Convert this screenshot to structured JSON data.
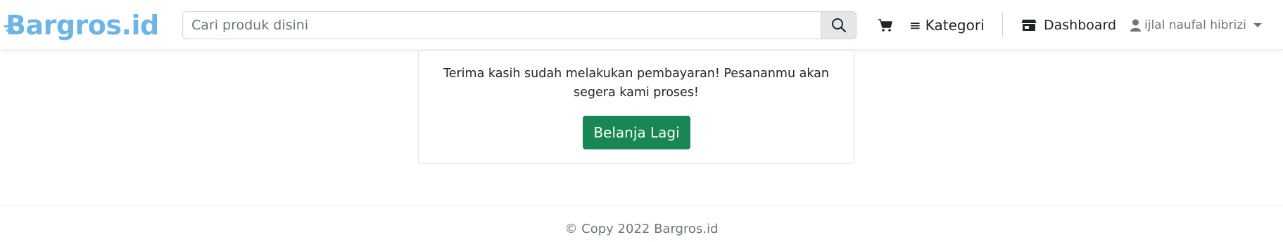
{
  "brand": {
    "name": "Bargros.id",
    "color": "#6cb5e6"
  },
  "search": {
    "placeholder": "Cari produk disini",
    "button_icon": "search-icon"
  },
  "nav": {
    "cart_icon": "cart-icon",
    "kategori_label": "Kategori",
    "dashboard_label": "Dashboard",
    "user_name": "ijlal naufal hibrizi"
  },
  "main": {
    "message": "Terima kasih sudah melakukan pembayaran! Pesananmu akan segera kami proses!",
    "button_label": "Belanja Lagi",
    "button_color": "#198754"
  },
  "footer": {
    "text": "© Copy 2022 Bargros.id"
  }
}
